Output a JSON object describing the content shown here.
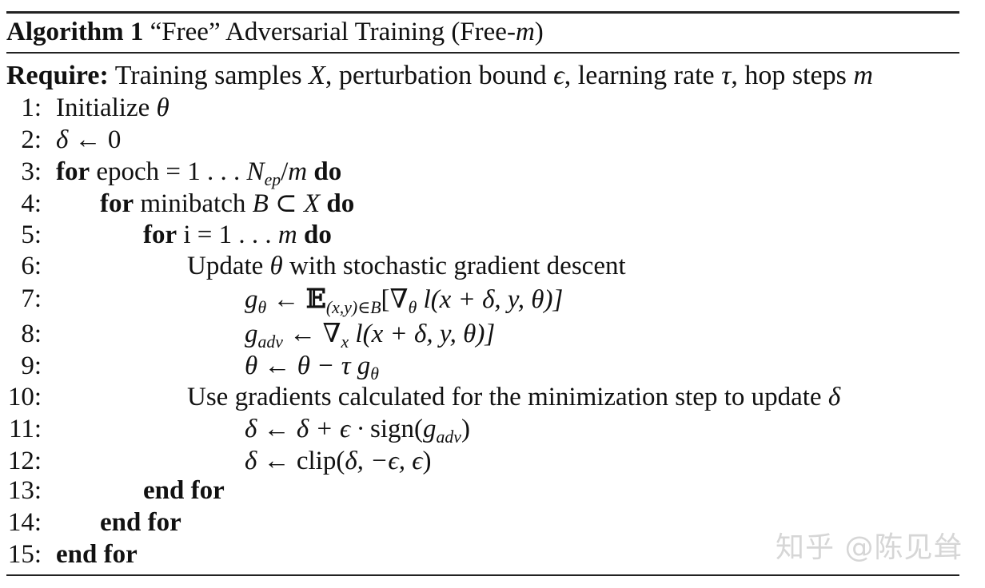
{
  "algorithm": {
    "label": "Algorithm 1",
    "title_prefix": "“Free” Adversarial Training (Free-",
    "title_var": "m",
    "title_suffix": ")"
  },
  "require": {
    "keyword": "Require:",
    "t1": "Training samples ",
    "v1": "X",
    "t2": ", perturbation bound ",
    "v2": "ϵ",
    "t3": ", learning rate ",
    "v3": "τ",
    "t4": ", hop steps ",
    "v4": "m"
  },
  "steps": [
    {
      "n": "1:",
      "a": "Initialize ",
      "b": "θ"
    },
    {
      "n": "2:",
      "a": "δ",
      "b": " ← 0"
    },
    {
      "n": "3:",
      "kw": "for",
      "a": " epoch = 1 . . . ",
      "v": "N",
      "sub": "ep",
      "c": "/",
      "d": "m",
      "kw2": " do"
    },
    {
      "n": "4:",
      "kw": "for",
      "a": " minibatch ",
      "v": "B",
      "c": " ⊂ ",
      "d": "X",
      "kw2": " do"
    },
    {
      "n": "5:",
      "kw": "for",
      "a": " i = 1 . . . ",
      "d": "m",
      "kw2": " do"
    },
    {
      "n": "6:",
      "a": "Update ",
      "b": "θ",
      "c": " with stochastic gradient descent"
    },
    {
      "n": "7:",
      "g": "g",
      "gsub": "θ",
      "arrow": " ← ",
      "E": "𝔼",
      "esub": "(x,y)∈B",
      "open": "[∇",
      "nsub": "θ",
      "l": " l",
      "args": "(x + δ, y, θ)]"
    },
    {
      "n": "8:",
      "g": "g",
      "gsub": "adv",
      "arrow": " ← ",
      "open": "∇",
      "nsub": "x",
      "l": " l",
      "args": "(x + δ, y, θ)]"
    },
    {
      "n": "9:",
      "a": "θ",
      "arrow": " ← ",
      "b": "θ − τ g",
      "gsub": "θ"
    },
    {
      "n": "10:",
      "a": "Use gradients calculated for the minimization step to update ",
      "b": "δ"
    },
    {
      "n": "11:",
      "a": "δ",
      "arrow": " ← ",
      "b": "δ + ϵ · ",
      "c": "sign(",
      "g": "g",
      "gsub": "adv",
      "close": ")"
    },
    {
      "n": "12:",
      "a": "δ",
      "arrow": " ← ",
      "c": "clip(",
      "b": "δ, −ϵ, ϵ",
      "close": ")"
    },
    {
      "n": "13:",
      "kw": "end for"
    },
    {
      "n": "14:",
      "kw": "end for"
    },
    {
      "n": "15:",
      "kw": "end for"
    }
  ],
  "watermark": "知乎 @陈见耸"
}
